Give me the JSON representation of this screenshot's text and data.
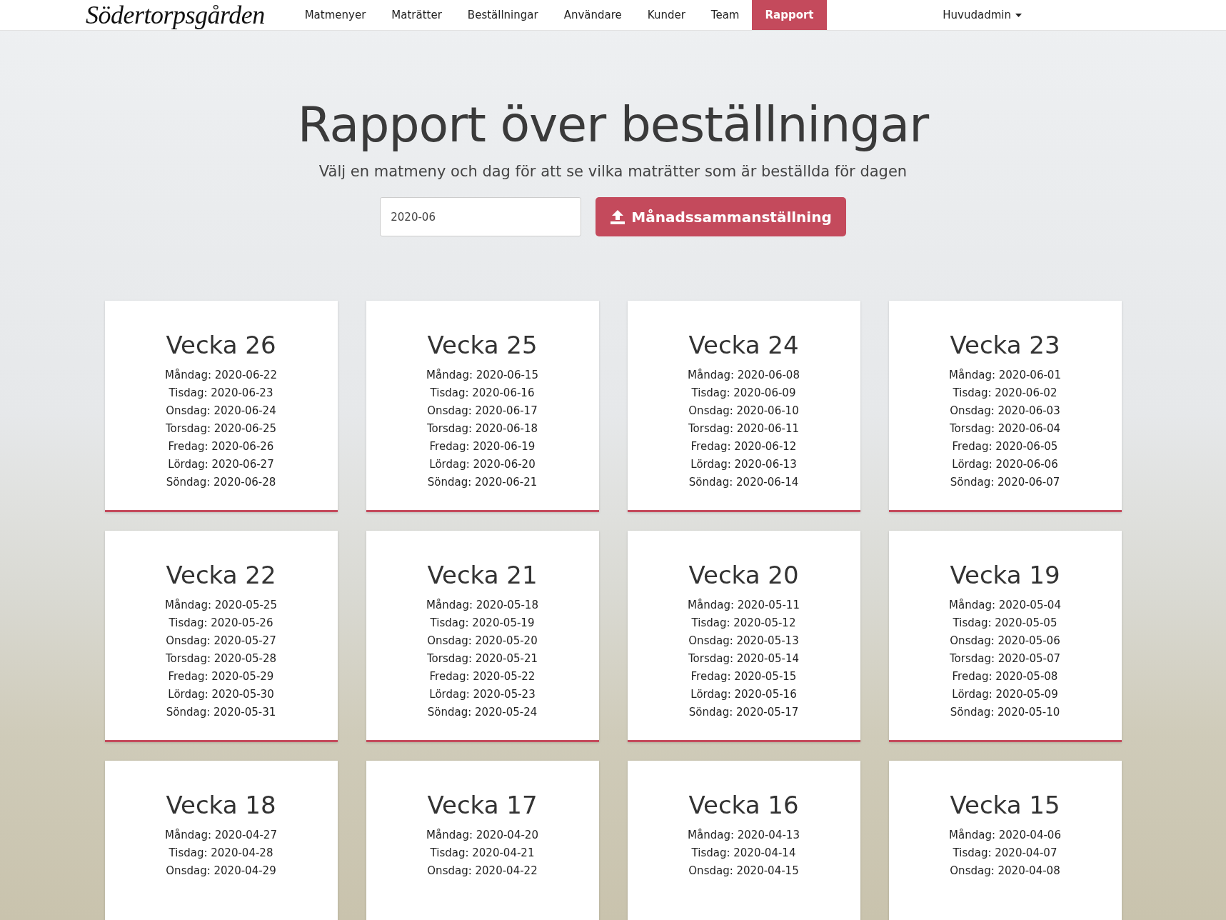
{
  "brand": "Södertorpsgården",
  "nav": [
    {
      "label": "Matmenyer",
      "selected": false
    },
    {
      "label": "Maträtter",
      "selected": false
    },
    {
      "label": "Beställningar",
      "selected": false
    },
    {
      "label": "Användare",
      "selected": false
    },
    {
      "label": "Kunder",
      "selected": false
    },
    {
      "label": "Team",
      "selected": false
    },
    {
      "label": "Rapport",
      "selected": true
    }
  ],
  "user_menu": "Huvudadmin",
  "heading": "Rapport över beställningar",
  "subheading": "Välj en matmeny och dag för att se vilka maträtter som är beställda för dagen",
  "month_field": {
    "value": "2020-06"
  },
  "summary_button": "Månadssammanställning",
  "weeks": [
    {
      "title": "Vecka 26",
      "days": [
        "Måndag: 2020-06-22",
        "Tisdag: 2020-06-23",
        "Onsdag: 2020-06-24",
        "Torsdag: 2020-06-25",
        "Fredag: 2020-06-26",
        "Lördag: 2020-06-27",
        "Söndag: 2020-06-28"
      ]
    },
    {
      "title": "Vecka 25",
      "days": [
        "Måndag: 2020-06-15",
        "Tisdag: 2020-06-16",
        "Onsdag: 2020-06-17",
        "Torsdag: 2020-06-18",
        "Fredag: 2020-06-19",
        "Lördag: 2020-06-20",
        "Söndag: 2020-06-21"
      ]
    },
    {
      "title": "Vecka 24",
      "days": [
        "Måndag: 2020-06-08",
        "Tisdag: 2020-06-09",
        "Onsdag: 2020-06-10",
        "Torsdag: 2020-06-11",
        "Fredag: 2020-06-12",
        "Lördag: 2020-06-13",
        "Söndag: 2020-06-14"
      ]
    },
    {
      "title": "Vecka 23",
      "days": [
        "Måndag: 2020-06-01",
        "Tisdag: 2020-06-02",
        "Onsdag: 2020-06-03",
        "Torsdag: 2020-06-04",
        "Fredag: 2020-06-05",
        "Lördag: 2020-06-06",
        "Söndag: 2020-06-07"
      ]
    },
    {
      "title": "Vecka 22",
      "days": [
        "Måndag: 2020-05-25",
        "Tisdag: 2020-05-26",
        "Onsdag: 2020-05-27",
        "Torsdag: 2020-05-28",
        "Fredag: 2020-05-29",
        "Lördag: 2020-05-30",
        "Söndag: 2020-05-31"
      ]
    },
    {
      "title": "Vecka 21",
      "days": [
        "Måndag: 2020-05-18",
        "Tisdag: 2020-05-19",
        "Onsdag: 2020-05-20",
        "Torsdag: 2020-05-21",
        "Fredag: 2020-05-22",
        "Lördag: 2020-05-23",
        "Söndag: 2020-05-24"
      ]
    },
    {
      "title": "Vecka 20",
      "days": [
        "Måndag: 2020-05-11",
        "Tisdag: 2020-05-12",
        "Onsdag: 2020-05-13",
        "Torsdag: 2020-05-14",
        "Fredag: 2020-05-15",
        "Lördag: 2020-05-16",
        "Söndag: 2020-05-17"
      ]
    },
    {
      "title": "Vecka 19",
      "days": [
        "Måndag: 2020-05-04",
        "Tisdag: 2020-05-05",
        "Onsdag: 2020-05-06",
        "Torsdag: 2020-05-07",
        "Fredag: 2020-05-08",
        "Lördag: 2020-05-09",
        "Söndag: 2020-05-10"
      ]
    },
    {
      "title": "Vecka 18",
      "days": [
        "Måndag: 2020-04-27",
        "Tisdag: 2020-04-28",
        "Onsdag: 2020-04-29"
      ]
    },
    {
      "title": "Vecka 17",
      "days": [
        "Måndag: 2020-04-20",
        "Tisdag: 2020-04-21",
        "Onsdag: 2020-04-22"
      ]
    },
    {
      "title": "Vecka 16",
      "days": [
        "Måndag: 2020-04-13",
        "Tisdag: 2020-04-14",
        "Onsdag: 2020-04-15"
      ]
    },
    {
      "title": "Vecka 15",
      "days": [
        "Måndag: 2020-04-06",
        "Tisdag: 2020-04-07",
        "Onsdag: 2020-04-08"
      ]
    }
  ]
}
